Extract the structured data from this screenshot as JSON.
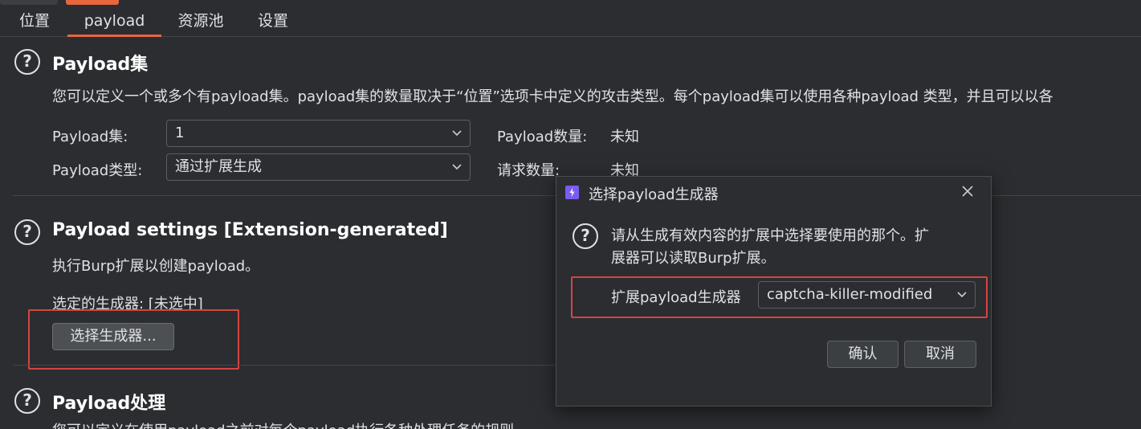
{
  "tabs": [
    {
      "label": "位置"
    },
    {
      "label": "payload",
      "active": true
    },
    {
      "label": "资源池"
    },
    {
      "label": "设置"
    }
  ],
  "payload_sets": {
    "title": "Payload集",
    "description": "您可以定义一个或多个有payload集。payload集的数量取决于“位置”选项卡中定义的攻击类型。每个payload集可以使用各种payload 类型，并且可以以各",
    "set_label": "Payload集:",
    "set_value": "1",
    "type_label": "Payload类型:",
    "type_value": "通过扩展生成",
    "count_label": "Payload数量:",
    "count_value": "未知",
    "request_label": "请求数量:",
    "request_value": "未知"
  },
  "payload_settings": {
    "title": "Payload settings [Extension-generated]",
    "description": "执行Burp扩展以创建payload。",
    "selected_generator": "选定的生成器: [未选中]",
    "select_button": "选择生成器..."
  },
  "payload_processing": {
    "title": "Payload处理",
    "description": "您可以定义在使用payload之前对每个payload执行各种处理任务的规则。"
  },
  "dialog": {
    "title": "选择payload生成器",
    "message_line1": "请从生成有效内容的扩展中选择要使用的那个。扩",
    "message_line2": "展器可以读取Burp扩展。",
    "field_label": "扩展payload生成器",
    "field_value": "captcha-killer-modified",
    "ok_button": "确认",
    "cancel_button": "取消"
  },
  "colors": {
    "background": "#2b2d30",
    "accent": "#e8663d",
    "highlight_box": "#d64540",
    "dialog_app_icon": "#7b5cf0"
  },
  "icons": [
    "help-icon",
    "chevron-down-icon",
    "close-icon",
    "burp-app-icon"
  ]
}
